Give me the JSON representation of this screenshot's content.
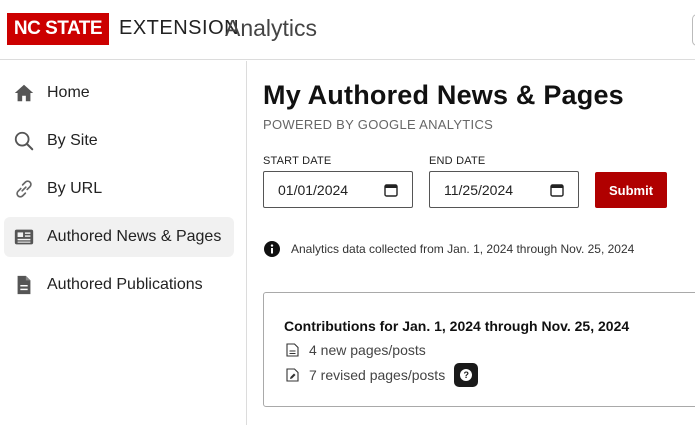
{
  "header": {
    "logo_text": "NC STATE",
    "brand_extension": "EXTENSION",
    "brand_analytics": "Analytics"
  },
  "sidebar": {
    "items": [
      {
        "label": "Home",
        "icon": "home-icon"
      },
      {
        "label": "By Site",
        "icon": "search-icon"
      },
      {
        "label": "By URL",
        "icon": "link-icon"
      },
      {
        "label": "Authored News & Pages",
        "icon": "newspaper-icon",
        "active": true
      },
      {
        "label": "Authored Publications",
        "icon": "document-icon"
      }
    ]
  },
  "main": {
    "title": "My Authored News & Pages",
    "subtitle": "POWERED BY GOOGLE ANALYTICS",
    "start_date_label": "START DATE",
    "start_date_value": "01/01/2024",
    "end_date_label": "END DATE",
    "end_date_value": "11/25/2024",
    "submit_label": "Submit",
    "info_text": "Analytics data collected from Jan. 1, 2024 through Nov. 25, 2024",
    "card": {
      "title": "Contributions for Jan. 1, 2024 through Nov. 25, 2024",
      "new_pages": "4 new pages/posts",
      "revised_pages": "7 revised pages/posts",
      "help_glyph": "?"
    }
  },
  "colors": {
    "brand_red": "#cc0000",
    "submit_red": "#b00000",
    "active_nav_bg": "#f1f1f1"
  }
}
